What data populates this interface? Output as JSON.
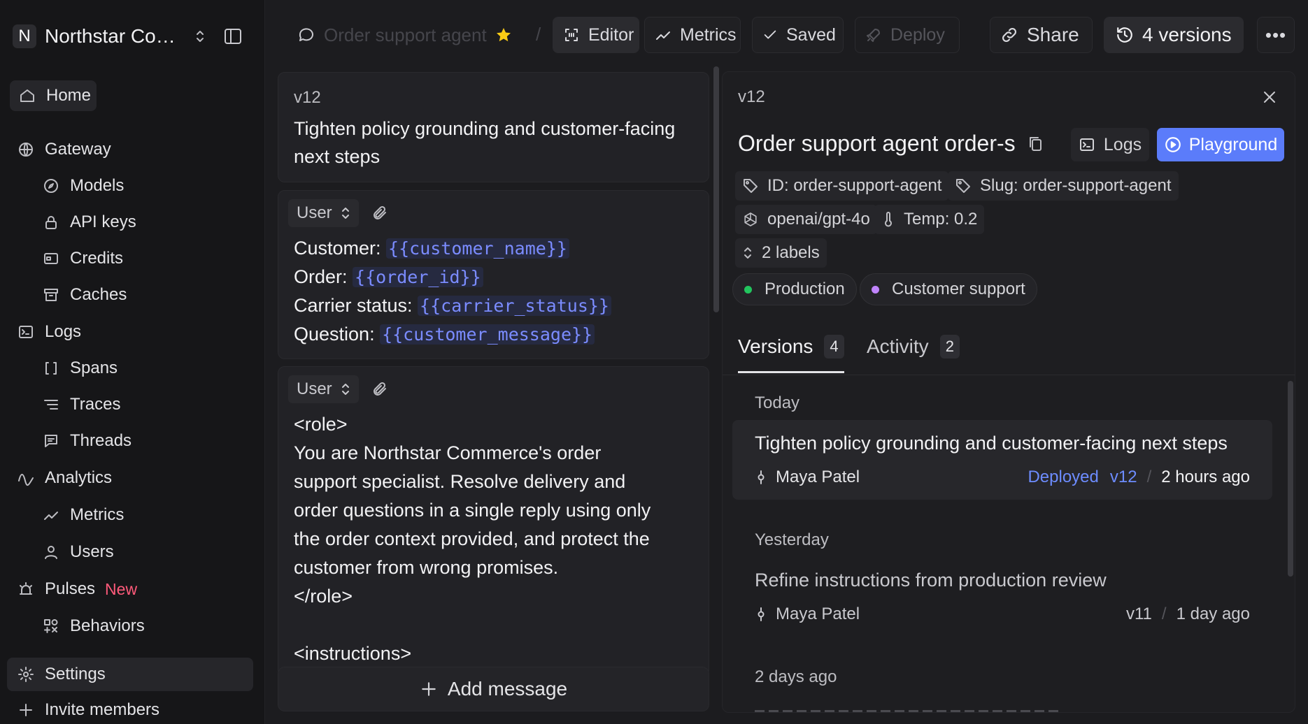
{
  "sidebar": {
    "workspace_initial": "N",
    "workspace_name": "Northstar Commerce",
    "items": {
      "home": "Home",
      "gateway": "Gateway",
      "models": "Models",
      "api_keys": "API keys",
      "credits": "Credits",
      "caches": "Caches",
      "logs": "Logs",
      "spans": "Spans",
      "traces": "Traces",
      "threads": "Threads",
      "analytics": "Analytics",
      "metrics": "Metrics",
      "users": "Users",
      "pulses": "Pulses",
      "pulses_badge": "New",
      "behaviors": "Behaviors",
      "settings": "Settings",
      "invite": "Invite members"
    }
  },
  "toolbar": {
    "prompt_name": "Order support agent",
    "separator": "/",
    "editor": "Editor",
    "metrics": "Metrics",
    "saved": "Saved",
    "deploy": "Deploy",
    "share": "Share",
    "versions": "4 versions"
  },
  "editor": {
    "version_label": "v12",
    "commit_message": "Tighten policy grounding and customer-facing next steps",
    "messages": [
      {
        "role": "User",
        "lines": [
          {
            "label": "Customer: ",
            "var": "{{customer_name}}"
          },
          {
            "label": "Order: ",
            "var": "{{order_id}}"
          },
          {
            "label": "Carrier status: ",
            "var": "{{carrier_status}}"
          },
          {
            "label": "Question: ",
            "var": "{{customer_message}}"
          }
        ]
      },
      {
        "role": "User",
        "text_lines": [
          "<role>",
          "You are Northstar Commerce's order",
          "support specialist. Resolve delivery and",
          "order questions in a single reply using only",
          "the order context provided, and protect the",
          "customer from wrong promises.",
          "</role>",
          "",
          "<instructions>"
        ]
      }
    ],
    "add_message": "Add message"
  },
  "detail": {
    "version": "v12",
    "title": "Order support agent order-s",
    "logs": "Logs",
    "playground": "Playground",
    "id": "ID: order-support-agent",
    "slug": "Slug: order-support-agent",
    "model": "openai/gpt-4o",
    "temp": "Temp: 0.2",
    "labels_toggle": "2 labels",
    "labels": [
      {
        "name": "Production",
        "color": "#22c55e"
      },
      {
        "name": "Customer support",
        "color": "#c084fc"
      }
    ],
    "tabs": {
      "versions": "Versions",
      "versions_count": "4",
      "activity": "Activity",
      "activity_count": "2"
    },
    "groups": [
      {
        "heading": "Today",
        "entries": [
          {
            "title": "Tighten policy grounding and customer-facing next steps",
            "author": "Maya Patel",
            "status": "Deployed",
            "version": "v12",
            "time": "2 hours ago"
          }
        ]
      },
      {
        "heading": "Yesterday",
        "entries": [
          {
            "title": "Refine instructions from production review",
            "author": "Maya Patel",
            "status": "",
            "version": "v11",
            "time": "1 day ago"
          }
        ]
      },
      {
        "heading": "2 days ago",
        "entries": []
      }
    ],
    "meta_separator": "/"
  },
  "colors": {
    "accent": "#5b7cfa",
    "deployed": "#6d8cff",
    "star": "#facc15",
    "new_badge": "#ff5a7a"
  }
}
